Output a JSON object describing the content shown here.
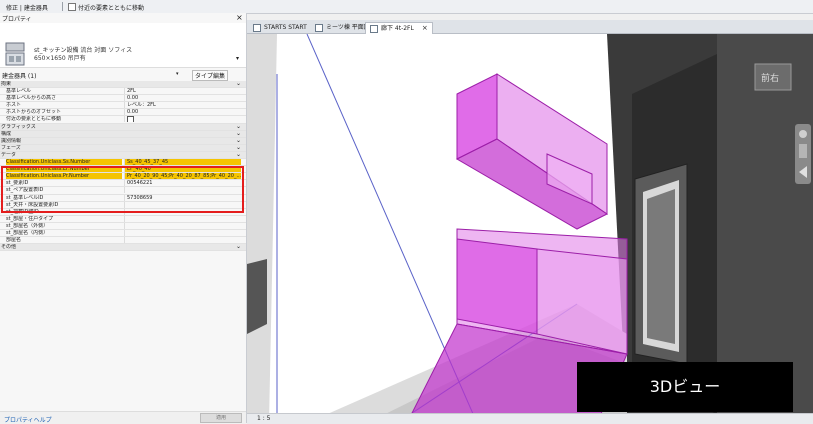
{
  "topbar": {
    "context": "修正 | 建金器具",
    "move_checkbox_label": "付近の要素とともに移動"
  },
  "panel": {
    "title": "プロパティ",
    "close": "×",
    "type_name": "st_キッチン設備 流台 対面 ソフィス",
    "type_size": "650×1650 吊戸有",
    "selection_label": "建金器具 (1)",
    "edit_type_label": "タイプ編集",
    "help_link": "プロパティヘルプ",
    "apply_button": "適用",
    "rows": [
      {
        "type": "group",
        "key": "拘束",
        "toggle": "⌄"
      },
      {
        "key": "基準レベル",
        "value": "2FL"
      },
      {
        "key": "基準レベルからの高さ",
        "value": "0.00"
      },
      {
        "key": "ホスト",
        "value": "レベル：2FL"
      },
      {
        "key": "ホストからのオフセット",
        "value": "0.00"
      },
      {
        "key": "付近の要素とともに移動",
        "value": "",
        "checkbox": true
      },
      {
        "type": "group",
        "key": "グラフィックス",
        "toggle": "⌄"
      },
      {
        "type": "group",
        "key": "構成",
        "toggle": "⌄"
      },
      {
        "type": "group",
        "key": "識別情報",
        "toggle": "⌄"
      },
      {
        "type": "group",
        "key": "フェーズ",
        "toggle": "⌄"
      },
      {
        "type": "group",
        "key": "データ",
        "toggle": "⌄"
      },
      {
        "key": "Classification.Uniclass.Ss.Number",
        "value": "Ss_40_45_37_45",
        "hl": true
      },
      {
        "key": "Classification.Uniclass.EF.Number",
        "value": "EF_40_40",
        "hl": true
      },
      {
        "key": "Classification.Uniclass.Pr.Number",
        "value": "Pr_40_20_90_45;Pr_40_20_87_85;Pr_40_20_...",
        "hl": true
      },
      {
        "key": "st_要素ID",
        "value": "00546221"
      },
      {
        "key": "st_ペア設置表ID",
        "value": ""
      },
      {
        "key": "st_基準レベルID",
        "value": "57308659"
      },
      {
        "key": "st_天井・床設置要素ID",
        "value": ""
      },
      {
        "key": "st_埋葬ID壁ID",
        "value": ""
      },
      {
        "key": "st_部屋・住戸タイプ",
        "value": ""
      },
      {
        "key": "st_部屋名（外側）",
        "value": ""
      },
      {
        "key": "st_部屋名（内側）",
        "value": ""
      },
      {
        "key": "部屋名",
        "value": ""
      },
      {
        "type": "group",
        "key": "その他",
        "toggle": "⌄"
      }
    ]
  },
  "tabs": [
    {
      "label": "STARTS START",
      "active": false
    },
    {
      "label": "ミーツ棟 平面図",
      "active": false
    },
    {
      "label": "廊下 4t-2FL",
      "active": true
    }
  ],
  "view_label": "3Dビュー",
  "viewcube_label": "前右",
  "scale_text": "1 : 5",
  "colors": {
    "highlight": "#f5c400",
    "redbox": "#e41d1d",
    "magenta": "#d63be0"
  }
}
